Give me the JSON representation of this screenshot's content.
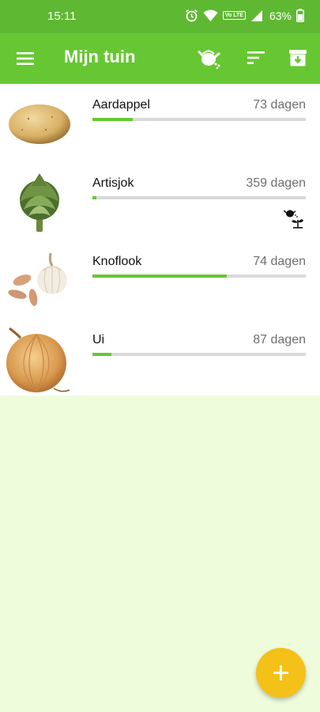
{
  "status_bar": {
    "time": "15:11",
    "volte_label": "Vo LTE",
    "battery_percent": "63%"
  },
  "toolbar": {
    "title": "Mijn tuin",
    "icons": [
      "menu-icon",
      "watering-can-icon",
      "sort-icon",
      "archive-icon"
    ]
  },
  "crops": [
    {
      "name": "Aardappel",
      "days": "73 dagen",
      "progress_percent": 19,
      "image": "potato"
    },
    {
      "name": "Artisjok",
      "days": "359 dagen",
      "progress_percent": 2,
      "image": "artichoke",
      "needs_water_icon": true
    },
    {
      "name": "Knoflook",
      "days": "74 dagen",
      "progress_percent": 63,
      "image": "garlic"
    },
    {
      "name": "Ui",
      "days": "87 dagen",
      "progress_percent": 9,
      "image": "onion"
    }
  ],
  "fab": {
    "icon": "plus-icon"
  },
  "colors": {
    "toolbar": "#66c733",
    "status_bar": "#5fb832",
    "progress": "#66c733",
    "fab": "#f3c117",
    "background": "#effcdc"
  }
}
